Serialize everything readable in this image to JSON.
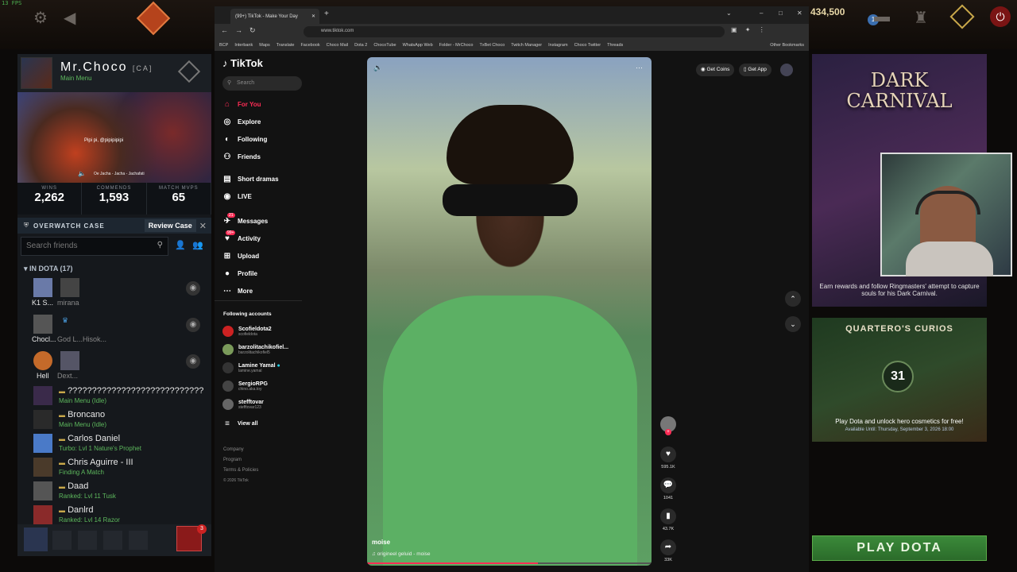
{
  "fps": "13 FPS",
  "dota": {
    "currency": "434,500",
    "notif_count": "1",
    "party_count": "3"
  },
  "profile": {
    "name": "Mr.Choco",
    "tag": "[CA]",
    "status": "Main Menu",
    "banner_name": "Pipi pi, @pipipipipi",
    "banner_song": "Oe Jacha - Jacha - Jachafati",
    "stats": [
      {
        "label": "WINS",
        "value": "2,262"
      },
      {
        "label": "COMMENDS",
        "value": "1,593"
      },
      {
        "label": "MATCH MVPS",
        "value": "65"
      }
    ]
  },
  "overwatch": {
    "label": "OVERWATCH CASE",
    "button": "Review Case"
  },
  "friends": {
    "search_placeholder": "Search friends",
    "group_label": "IN DOTA",
    "group_count": "(17)",
    "party_rows": [
      {
        "a": "K1 S...",
        "b": "mirana"
      },
      {
        "a": "Chocl...",
        "b": "God L...Hisok..."
      },
      {
        "a": "Hell",
        "b": "Dext..."
      }
    ],
    "list": [
      {
        "name": "????????????????????????????",
        "status": "Main Menu (Idle)"
      },
      {
        "name": "Broncano",
        "status": "Main Menu (Idle)"
      },
      {
        "name": "Carlos Daniel",
        "status": "Turbo: Lvl 1 Nature's Prophet"
      },
      {
        "name": "Chris Aguirre - III",
        "status": "Finding A Match"
      },
      {
        "name": "Daad",
        "status": "Ranked: Lvl 11 Tusk"
      },
      {
        "name": "Danlrd",
        "status": "Ranked: Lvl 14 Razor"
      }
    ]
  },
  "browser": {
    "tab_title": "(99+) TikTok - Make Your Day",
    "url": "www.tiktok.com",
    "bookmarks": [
      "BCP",
      "Interbank",
      "Maps",
      "Translate",
      "Facebook",
      "Choco Mail",
      "Dota 2",
      "ChocoTube",
      "WhatsApp Web",
      "Folder - MrChoco",
      "TxBet Choco",
      "Twitch Manager",
      "Instagram",
      "Choco Twitter",
      "Threads",
      "Other Bookmarks"
    ]
  },
  "tiktok": {
    "logo": "TikTok",
    "search_placeholder": "Search",
    "nav": [
      {
        "label": "For You",
        "icon": "home-icon"
      },
      {
        "label": "Explore",
        "icon": "compass-icon"
      },
      {
        "label": "Following",
        "icon": "following-icon"
      },
      {
        "label": "Friends",
        "icon": "friends-icon"
      },
      {
        "label": "Short dramas",
        "icon": "drama-icon"
      },
      {
        "label": "LIVE",
        "icon": "live-icon"
      },
      {
        "label": "Messages",
        "icon": "messages-icon"
      },
      {
        "label": "Activity",
        "icon": "activity-icon"
      },
      {
        "label": "Upload",
        "icon": "upload-icon"
      },
      {
        "label": "Profile",
        "icon": "profile-icon"
      },
      {
        "label": "More",
        "icon": "more-icon"
      }
    ],
    "messages_badge": "21",
    "activity_badge": "99+",
    "following_title": "Following accounts",
    "accounts": [
      {
        "name": "Scofieldota2",
        "sub": "scofieldota"
      },
      {
        "name": "barzolitachikofiel...",
        "sub": "barzolitachikofiel5"
      },
      {
        "name": "Lamine Yamal",
        "sub": "lamine.yamal"
      },
      {
        "name": "SergioRPG",
        "sub": "chino.aka.toy"
      },
      {
        "name": "stefftovar",
        "sub": "stefftovar123"
      }
    ],
    "view_all": "View all",
    "footer": [
      "Company",
      "Program",
      "Terms & Policies",
      "© 2026 TikTok"
    ],
    "get_coins": "Get Coins",
    "get_app": "Get App",
    "video_author": "moise",
    "video_sound": "origineel geluid - moise",
    "actions": [
      {
        "icon": "heart-icon",
        "count": "595.1K"
      },
      {
        "icon": "comment-icon",
        "count": "1041"
      },
      {
        "icon": "bookmark-icon",
        "count": "43.7K"
      },
      {
        "icon": "share-icon",
        "count": "33K"
      }
    ],
    "progress": 0.6
  },
  "right": {
    "event_title": "DARK CARNIVAL",
    "event_desc": "Earn rewards and follow Ringmasters' attempt to capture souls for his Dark Carnival.",
    "curios_title": "QUARTERO'S CURIOS",
    "curios_days": "31",
    "curios_desc": "Play Dota and unlock hero cosmetics for free!",
    "curios_until": "Available Until: Thursday, September 3, 2026 18:00",
    "play": "PLAY DOTA"
  }
}
